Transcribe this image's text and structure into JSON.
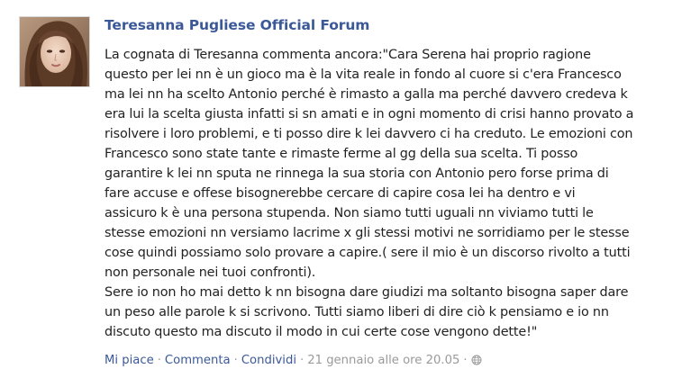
{
  "post": {
    "author": "Teresanna Pugliese Official Forum",
    "message_lines": [
      "La cognata di Teresanna commenta ancora:\"Cara Serena hai proprio ragione",
      "questo per lei nn è un gioco ma è la vita reale in fondo al cuore si c'era Francesco",
      "ma lei nn ha scelto Antonio perché è rimasto a galla ma perché davvero credeva k",
      "era lui la scelta giusta infatti si sn amati e in ogni momento di crisi hanno provato a",
      "risolvere i loro problemi, e ti posso dire k lei davvero ci ha creduto. Le emozioni con",
      "Francesco sono state tante e rimaste ferme al gg della sua scelta. Ti posso",
      "garantire k lei nn sputa ne rinnega la sua storia con Antonio pero forse prima di",
      "fare accuse e offese bisognerebbe cercare di capire cosa lei ha dentro e vi",
      "assicuro k è una persona stupenda. Non siamo tutti uguali nn viviamo tutti le",
      "stesse emozioni nn versiamo lacrime x gli stessi motivi ne sorridiamo per le stesse",
      "cose quindi possiamo solo provare a capire.( sere il mio è un discorso rivolto a tutti",
      "non personale nei tuoi confronti).",
      "Sere io non ho mai detto k nn bisogna dare giudizi ma soltanto bisogna saper dare",
      "un peso alle parole k si scrivono. Tutti siamo liberi di dire ciò k pensiamo e io nn",
      "discuto questo ma discuto il modo in cui certe cose vengono dette!\""
    ],
    "actions": {
      "like": "Mi piace",
      "comment": "Commenta",
      "share": "Condividi",
      "separator": "·",
      "timestamp": "21 gennaio alle ore 20.05"
    }
  },
  "colors": {
    "link": "#3b5998",
    "text": "#222222",
    "meta": "#9a9a9a"
  },
  "icons": {
    "time_icon": "globe-icon"
  }
}
